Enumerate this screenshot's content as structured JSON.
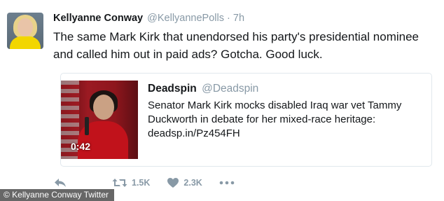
{
  "tweet": {
    "author_name": "Kellyanne Conway",
    "author_handle": "@KellyannePolls",
    "separator": "·",
    "time": "7h",
    "text": "The same Mark Kirk that unendorsed his party's presidential nominee and called him out in paid ads? Gotcha. Good luck."
  },
  "quoted": {
    "author_name": "Deadspin",
    "author_handle": "@Deadspin",
    "text_line1": "Senator Mark Kirk mocks disabled Iraq war vet Tammy",
    "text_line2": "Duckworth in debate for her mixed-race heritage:",
    "link": "deadsp.in/Pz454FH",
    "video_duration": "0:42"
  },
  "actions": {
    "reply_icon": "reply-icon",
    "retweet_icon": "retweet-icon",
    "retweet_count": "1.5K",
    "like_icon": "heart-icon",
    "like_count": "2.3K",
    "more_icon": "more-dots-icon"
  },
  "credit": "© Kellyanne Conway Twitter",
  "colors": {
    "text": "#14171a",
    "muted": "#8899a6",
    "card_border": "#e1e8ed"
  }
}
